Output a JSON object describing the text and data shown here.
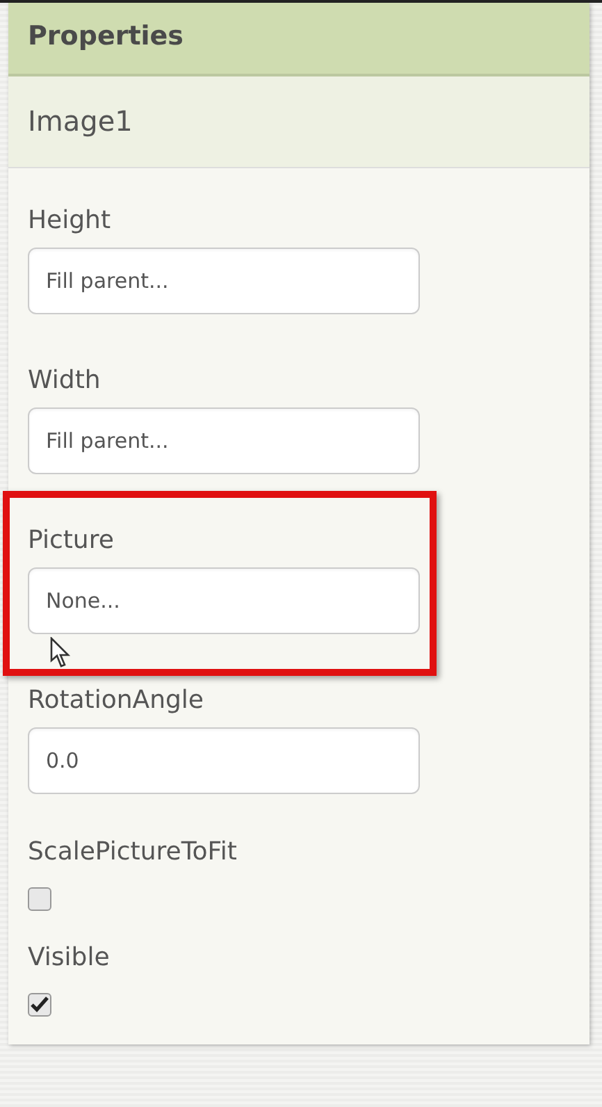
{
  "panel": {
    "title": "Properties"
  },
  "component": {
    "name": "Image1"
  },
  "properties": [
    {
      "label": "Height",
      "kind": "text",
      "value": "Fill parent...",
      "highlighted": false
    },
    {
      "label": "Width",
      "kind": "text",
      "value": "Fill parent...",
      "highlighted": false
    },
    {
      "label": "Picture",
      "kind": "text",
      "value": "None...",
      "highlighted": true
    },
    {
      "label": "RotationAngle",
      "kind": "text",
      "value": "0.0",
      "highlighted": false
    },
    {
      "label": "ScalePictureToFit",
      "kind": "checkbox",
      "checked": false,
      "highlighted": false
    },
    {
      "label": "Visible",
      "kind": "checkbox",
      "checked": true,
      "highlighted": false
    }
  ]
}
